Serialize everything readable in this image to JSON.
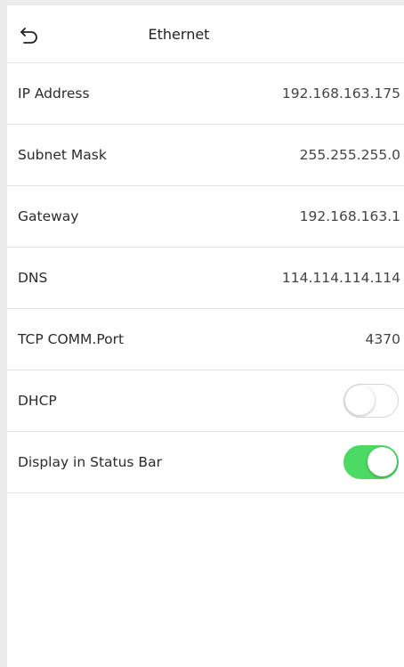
{
  "header": {
    "title": "Ethernet",
    "back_icon": "back-arrow-icon"
  },
  "rows": [
    {
      "label": "IP Address",
      "value": "192.168.163.175"
    },
    {
      "label": "Subnet Mask",
      "value": "255.255.255.0"
    },
    {
      "label": "Gateway",
      "value": "192.168.163.1"
    },
    {
      "label": "DNS",
      "value": "114.114.114.114"
    },
    {
      "label": "TCP COMM.Port",
      "value": "4370"
    }
  ],
  "toggles": [
    {
      "label": "DHCP",
      "state": "off"
    },
    {
      "label": "Display in Status Bar",
      "state": "on"
    }
  ],
  "colors": {
    "toggle_on": "#4cd964",
    "toggle_off_border": "#d6d6d6"
  }
}
